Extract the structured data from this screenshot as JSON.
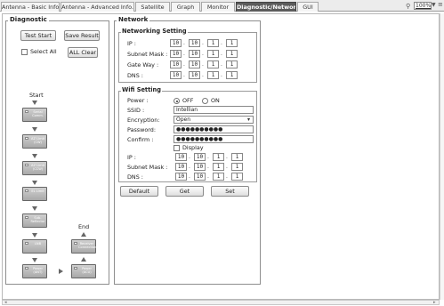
{
  "tabs": [
    {
      "label": "Antenna - Basic Info."
    },
    {
      "label": "Antenna - Advanced Info."
    },
    {
      "label": "Satellite"
    },
    {
      "label": "Graph"
    },
    {
      "label": "Monitor"
    },
    {
      "label": "Diagnostic/Network"
    },
    {
      "label": "GUI"
    }
  ],
  "toolbar": {
    "zoom_value": "100%"
  },
  "diagnostic": {
    "title": "Diagnostic",
    "test_start_label": "Test Start",
    "save_result_label": "Save Result",
    "select_all_label": "Select All",
    "all_clear_label": "ALL Clear",
    "start_label": "Start",
    "end_label": "End",
    "steps": [
      {
        "label": "Serial Comm."
      },
      {
        "label": "AZ Limit (CW)"
      },
      {
        "label": "AZ Limit (CCW)"
      },
      {
        "label": "EL Limit"
      },
      {
        "label": "Sub-Reflector"
      },
      {
        "label": "LNB"
      },
      {
        "label": "Power (ANT)"
      },
      {
        "label": "Power (ACU)"
      },
      {
        "label": "Receiver Connection"
      }
    ]
  },
  "network": {
    "title": "Network",
    "networking": {
      "title": "Networking Setting",
      "ip_label": "IP :",
      "subnet_label": "Subnet Mask :",
      "gateway_label": "Gate Way :",
      "dns_label": "DNS :",
      "ip": [
        "10",
        "10",
        "1",
        "1"
      ],
      "subnet": [
        "10",
        "10",
        "1",
        "1"
      ],
      "gateway": [
        "10",
        "10",
        "1",
        "1"
      ],
      "dns": [
        "10",
        "10",
        "1",
        "1"
      ]
    },
    "wifi": {
      "title": "Wifi Setting",
      "power_label": "Power :",
      "off_label": "OFF",
      "on_label": "ON",
      "ssid_label": "SSID :",
      "ssid_value": "Intellian",
      "encryption_label": "Encryption:",
      "encryption_value": "Open",
      "password_label": "Password:",
      "password_value": "●●●●●●●●●●",
      "confirm_label": "Confirm :",
      "confirm_value": "●●●●●●●●●●",
      "display_label": "Display",
      "ip_label": "IP :",
      "subnet_label": "Subnet Mask :",
      "dns_label": "DNS :",
      "ip": [
        "10",
        "10",
        "1",
        "1"
      ],
      "subnet": [
        "10",
        "10",
        "1",
        "1"
      ],
      "dns": [
        "10",
        "10",
        "1",
        "1"
      ]
    },
    "default_label": "Default",
    "get_label": "Get",
    "set_label": "Set"
  }
}
